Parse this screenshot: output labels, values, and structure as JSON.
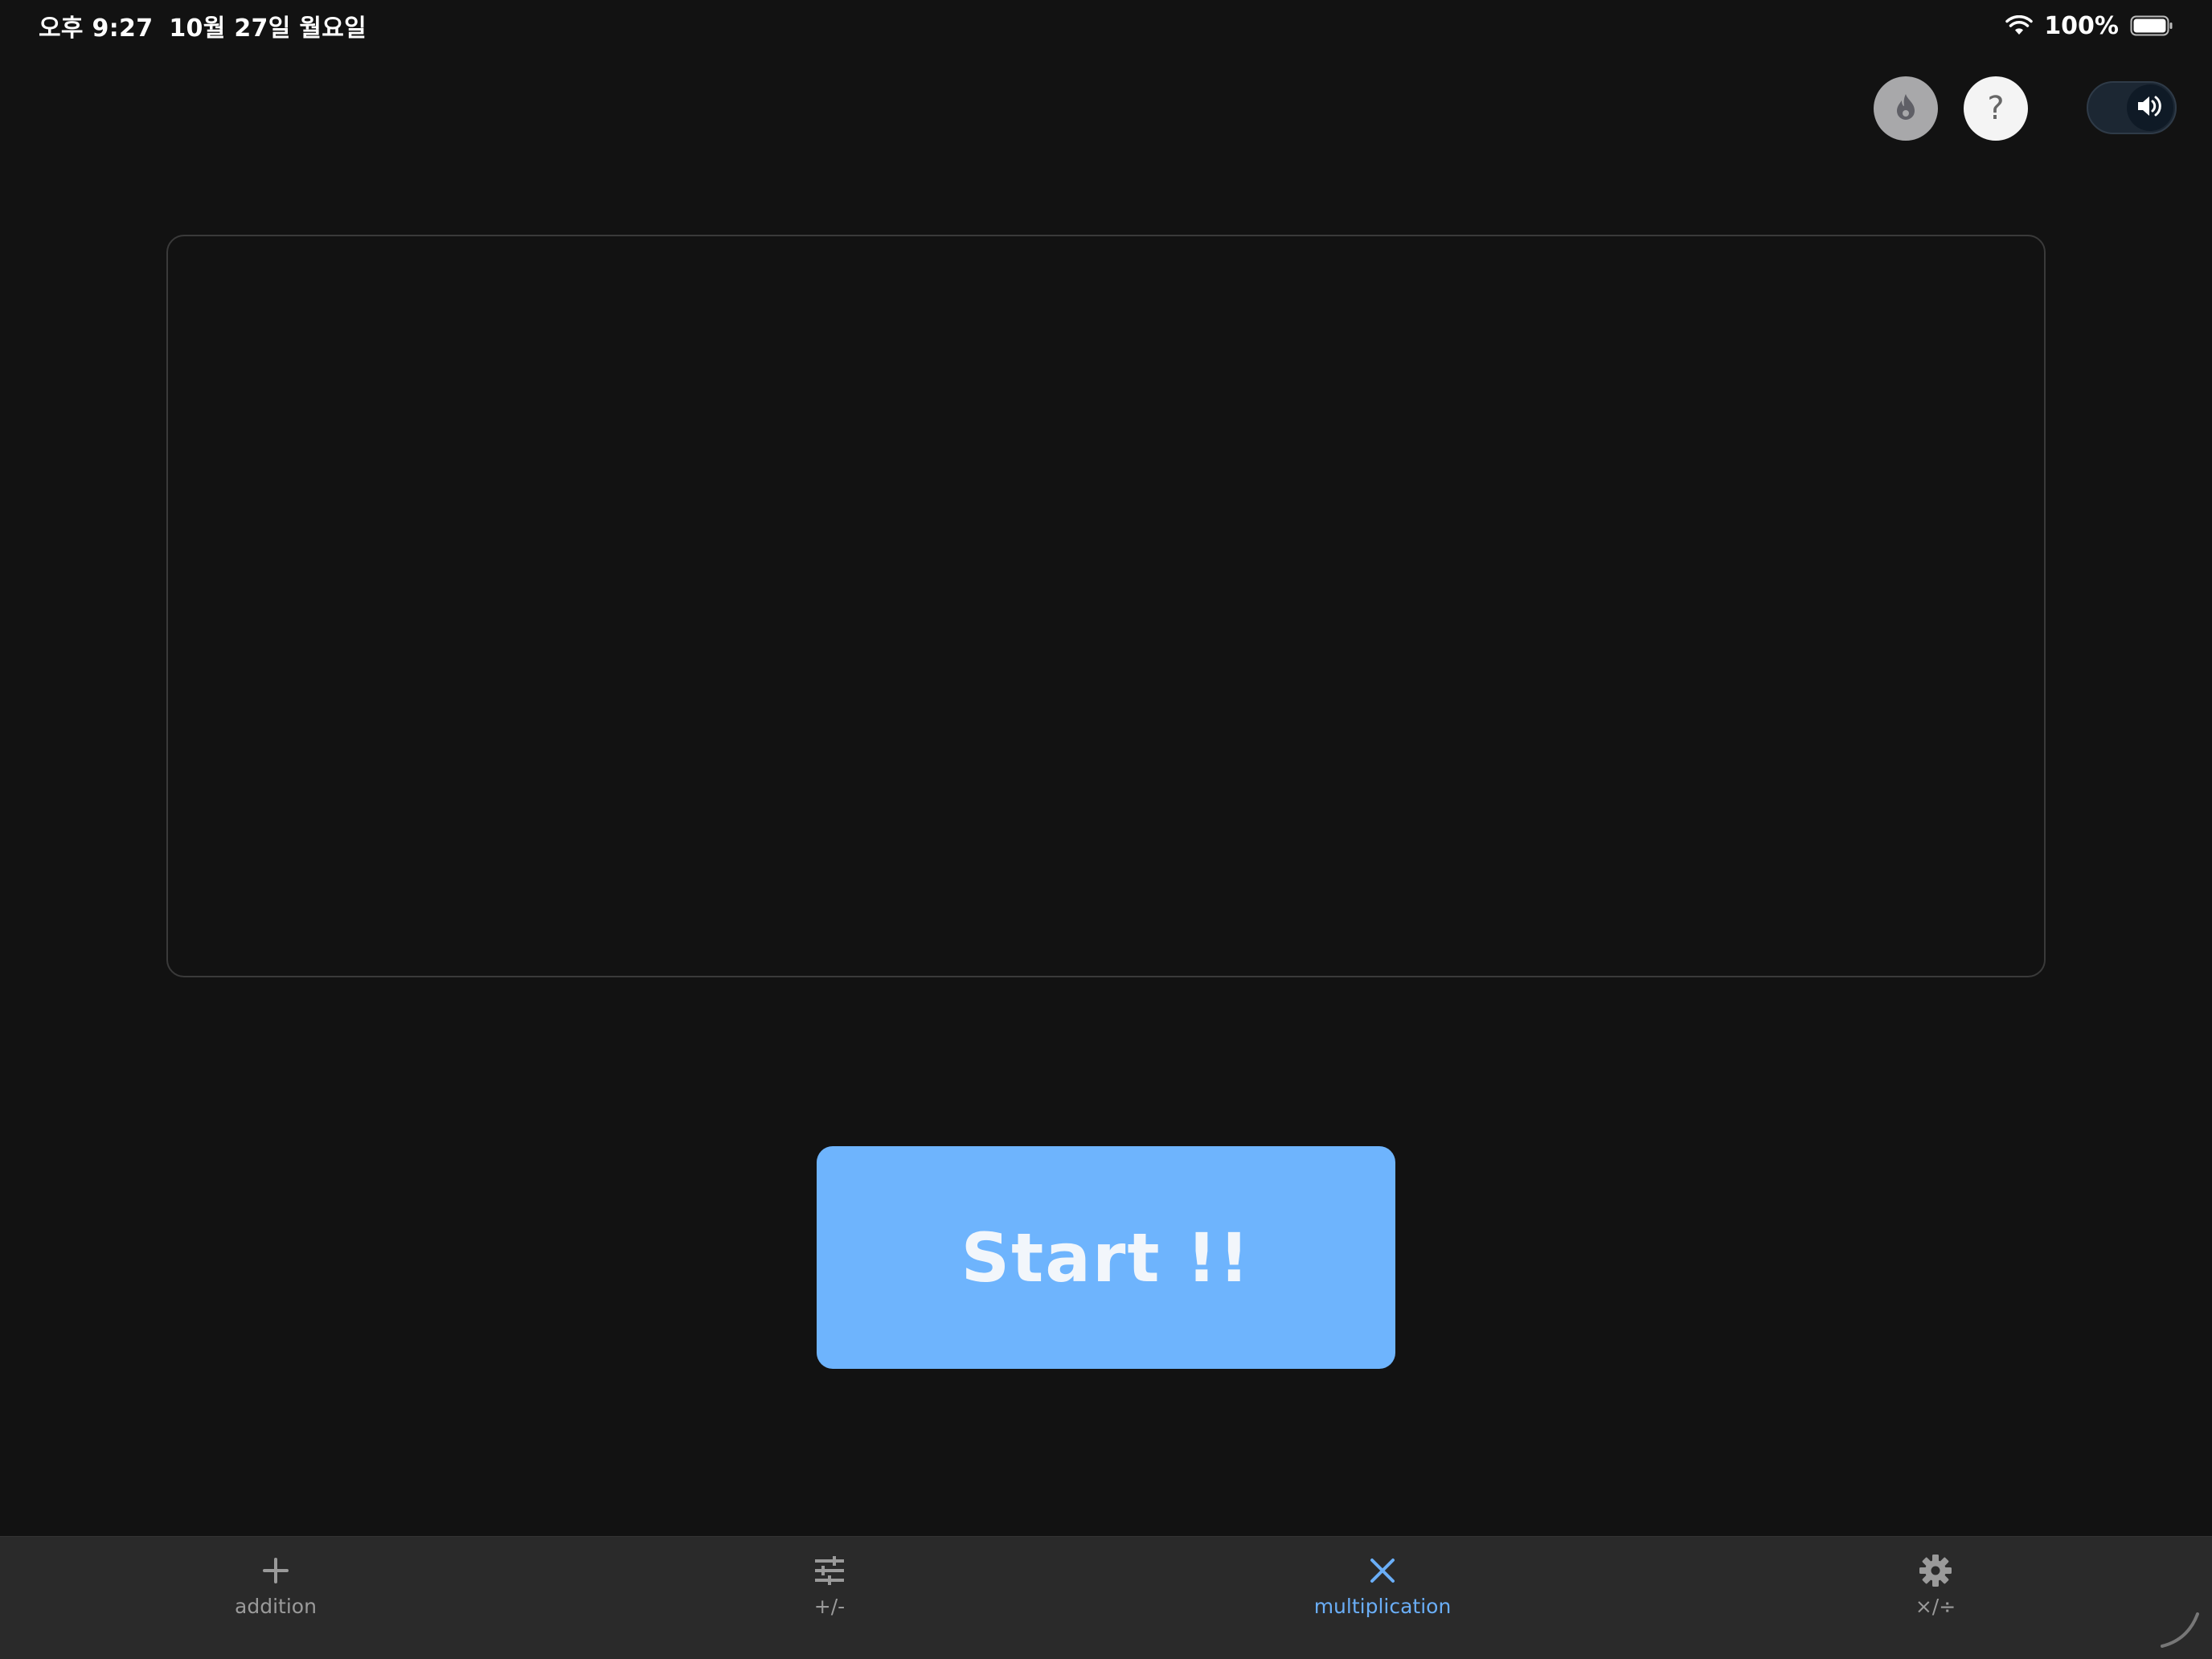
{
  "status_bar": {
    "time": "오후 9:27",
    "date": "10월 27일 월요일",
    "battery": "100%"
  },
  "top_controls": {
    "help_label": "?",
    "sound_icon": "speaker-icon",
    "streak_icon": "flame-icon"
  },
  "start_button": {
    "label": "Start !!"
  },
  "tabs": [
    {
      "label": "addition",
      "icon": "plus-icon",
      "active": false
    },
    {
      "label": "+/-",
      "icon": "sliders-icon",
      "active": false
    },
    {
      "label": "multiplication",
      "icon": "times-icon",
      "active": true
    },
    {
      "label": "×/÷",
      "icon": "gear-icon",
      "active": false
    }
  ],
  "colors": {
    "background": "#121212",
    "accent": "#6eb4fd",
    "tab_active": "#6aaef7",
    "tab_inactive": "#9a9a9a"
  }
}
